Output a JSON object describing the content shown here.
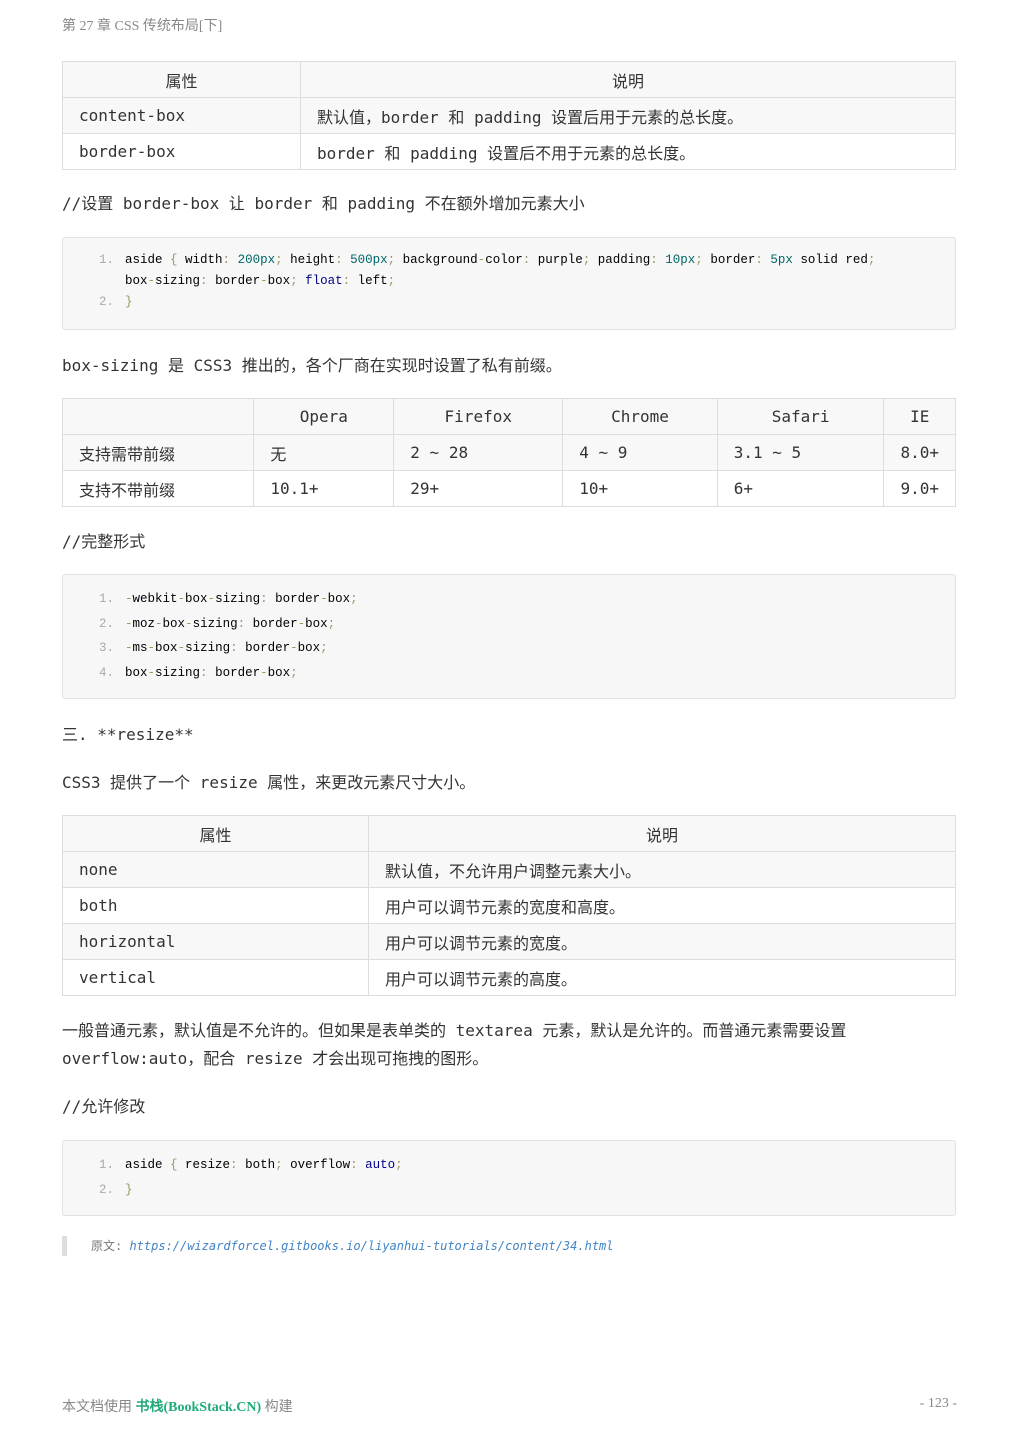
{
  "header": "第 27 章 CSS 传统布局[下]",
  "table1": {
    "headers": [
      "属性",
      "说明"
    ],
    "rows": [
      [
        "content-box",
        "默认值，border 和 padding 设置后用于元素的总长度。"
      ],
      [
        "border-box",
        "border 和 padding 设置后不用于元素的总长度。"
      ]
    ]
  },
  "comment1": "//设置 border-box 让 border 和 padding 不在额外增加元素大小",
  "code1": [
    {
      "num": "1.",
      "tokens": [
        [
          "aside ",
          "p"
        ],
        [
          "{",
          "u"
        ],
        [
          " width",
          "p"
        ],
        [
          ":",
          "u"
        ],
        [
          " 200px",
          "n"
        ],
        [
          ";",
          "u"
        ],
        [
          " height",
          "p"
        ],
        [
          ":",
          "u"
        ],
        [
          " 500px",
          "n"
        ],
        [
          ";",
          "u"
        ],
        [
          " background",
          "p"
        ],
        [
          "-",
          "u"
        ],
        [
          "color",
          "p"
        ],
        [
          ":",
          "u"
        ],
        [
          " purple",
          "p"
        ],
        [
          ";",
          "u"
        ],
        [
          " padding",
          "p"
        ],
        [
          ":",
          "u"
        ],
        [
          " 10px",
          "n"
        ],
        [
          ";",
          "u"
        ],
        [
          " border",
          "p"
        ],
        [
          ":",
          "u"
        ],
        [
          " 5px",
          "n"
        ],
        [
          " solid red",
          "p"
        ],
        [
          ";",
          "u"
        ],
        [
          " box",
          "p"
        ],
        [
          "-",
          "u"
        ],
        [
          "sizing",
          "p"
        ],
        [
          ":",
          "u"
        ],
        [
          " border",
          "p"
        ],
        [
          "-",
          "u"
        ],
        [
          "box",
          "p"
        ],
        [
          ";",
          "u"
        ],
        [
          " float",
          "k"
        ],
        [
          ":",
          "u"
        ],
        [
          " left",
          "p"
        ],
        [
          ";",
          "u"
        ]
      ]
    },
    {
      "num": "2.",
      "tokens": [
        [
          "}",
          "u"
        ]
      ]
    }
  ],
  "para1": "box-sizing 是 CSS3 推出的，各个厂商在实现时设置了私有前缀。",
  "table2": {
    "headers": [
      "",
      "Opera",
      "Firefox",
      "Chrome",
      "Safari",
      "IE"
    ],
    "rows": [
      [
        "支持需带前缀",
        "无",
        "2 ~ 28",
        "4 ~ 9",
        "3.1 ~ 5",
        "8.0+"
      ],
      [
        "支持不带前缀",
        "10.1+",
        "29+",
        "10+",
        "6+",
        "9.0+"
      ]
    ]
  },
  "comment2": "//完整形式",
  "code2": [
    {
      "num": "1.",
      "tokens": [
        [
          "-",
          "u"
        ],
        [
          "webkit",
          "p"
        ],
        [
          "-",
          "u"
        ],
        [
          "box",
          "p"
        ],
        [
          "-",
          "u"
        ],
        [
          "sizing",
          "p"
        ],
        [
          ":",
          "u"
        ],
        [
          " border",
          "p"
        ],
        [
          "-",
          "u"
        ],
        [
          "box",
          "p"
        ],
        [
          ";",
          "u"
        ]
      ]
    },
    {
      "num": "2.",
      "tokens": [
        [
          "-",
          "u"
        ],
        [
          "moz",
          "p"
        ],
        [
          "-",
          "u"
        ],
        [
          "box",
          "p"
        ],
        [
          "-",
          "u"
        ],
        [
          "sizing",
          "p"
        ],
        [
          ":",
          "u"
        ],
        [
          " border",
          "p"
        ],
        [
          "-",
          "u"
        ],
        [
          "box",
          "p"
        ],
        [
          ";",
          "u"
        ]
      ]
    },
    {
      "num": "3.",
      "tokens": [
        [
          "-",
          "u"
        ],
        [
          "ms",
          "p"
        ],
        [
          "-",
          "u"
        ],
        [
          "box",
          "p"
        ],
        [
          "-",
          "u"
        ],
        [
          "sizing",
          "p"
        ],
        [
          ":",
          "u"
        ],
        [
          " border",
          "p"
        ],
        [
          "-",
          "u"
        ],
        [
          "box",
          "p"
        ],
        [
          ";",
          "u"
        ]
      ]
    },
    {
      "num": "4.",
      "tokens": [
        [
          "box",
          "p"
        ],
        [
          "-",
          "u"
        ],
        [
          "sizing",
          "p"
        ],
        [
          ":",
          "u"
        ],
        [
          " border",
          "p"
        ],
        [
          "-",
          "u"
        ],
        [
          "box",
          "p"
        ],
        [
          ";",
          "u"
        ]
      ]
    }
  ],
  "heading3": "三. **resize**",
  "para2": "CSS3 提供了一个 resize 属性，来更改元素尺寸大小。",
  "table3": {
    "headers": [
      "属性",
      "说明"
    ],
    "rows": [
      [
        "none",
        "默认值，不允许用户调整元素大小。"
      ],
      [
        "both",
        "用户可以调节元素的宽度和高度。"
      ],
      [
        "horizontal",
        "用户可以调节元素的宽度。"
      ],
      [
        "vertical",
        "用户可以调节元素的高度。"
      ]
    ]
  },
  "para3_line1": "一般普通元素，默认值是不允许的。但如果是表单类的 textarea 元素，默认是允许的。而普通元素需要设置",
  "para3_line2": "overflow:auto，配合 resize 才会出现可拖拽的图形。",
  "comment3": "//允许修改",
  "code3": [
    {
      "num": "1.",
      "tokens": [
        [
          "aside ",
          "p"
        ],
        [
          "{",
          "u"
        ],
        [
          " resize",
          "p"
        ],
        [
          ":",
          "u"
        ],
        [
          " both",
          "p"
        ],
        [
          ";",
          "u"
        ],
        [
          " overflow",
          "p"
        ],
        [
          ":",
          "u"
        ],
        [
          " auto",
          "k"
        ],
        [
          ";",
          "u"
        ]
      ]
    },
    {
      "num": "2.",
      "tokens": [
        [
          "}",
          "u"
        ]
      ]
    }
  ],
  "source": {
    "label": "原文: ",
    "url": "https://wizardforcel.gitbooks.io/liyanhui-tutorials/content/34.html"
  },
  "footer": {
    "prefix": "本文档使用 ",
    "brand": "书栈(BookStack.CN)",
    "suffix": " 构建",
    "page": "- 123 -"
  }
}
